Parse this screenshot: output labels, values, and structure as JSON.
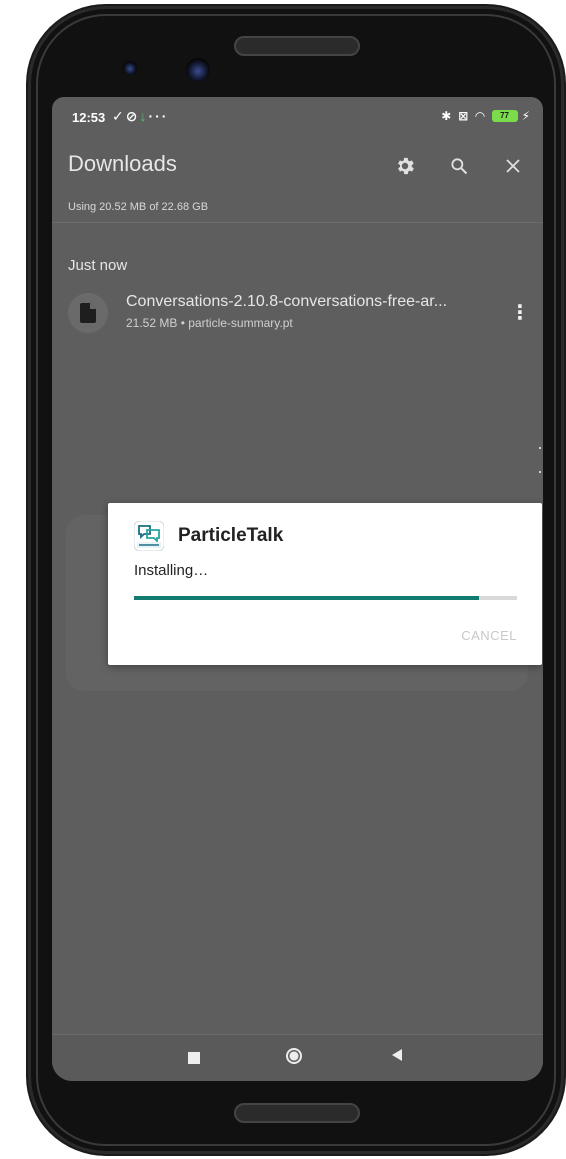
{
  "status_bar": {
    "time": "12:53",
    "left_icons": [
      "check-download-icon",
      "blocked-icon",
      "download-arrow-icon",
      "more-dots-icon"
    ],
    "battery": "77"
  },
  "app_bar": {
    "title": "Downloads",
    "actions": [
      "gear-icon",
      "search-icon",
      "close-icon"
    ]
  },
  "storage": {
    "usage_text": "Using 20.52 MB of 22.68 GB"
  },
  "downloads": {
    "section_header": "Just now",
    "items": [
      {
        "name": "Conversations-2.10.8-conversations-free-ar...",
        "meta": "21.52 MB • particle-summary.pt"
      }
    ]
  },
  "dialog": {
    "app_name": "ParticleTalk",
    "status": "Installing…",
    "progress": 0.9,
    "cancel_label": "CANCEL",
    "colors": {
      "progress": "#137a6f",
      "track": "#d9d9d9"
    }
  },
  "nav_bar": {
    "buttons": [
      "recent-apps-button",
      "home-button",
      "back-button"
    ]
  }
}
